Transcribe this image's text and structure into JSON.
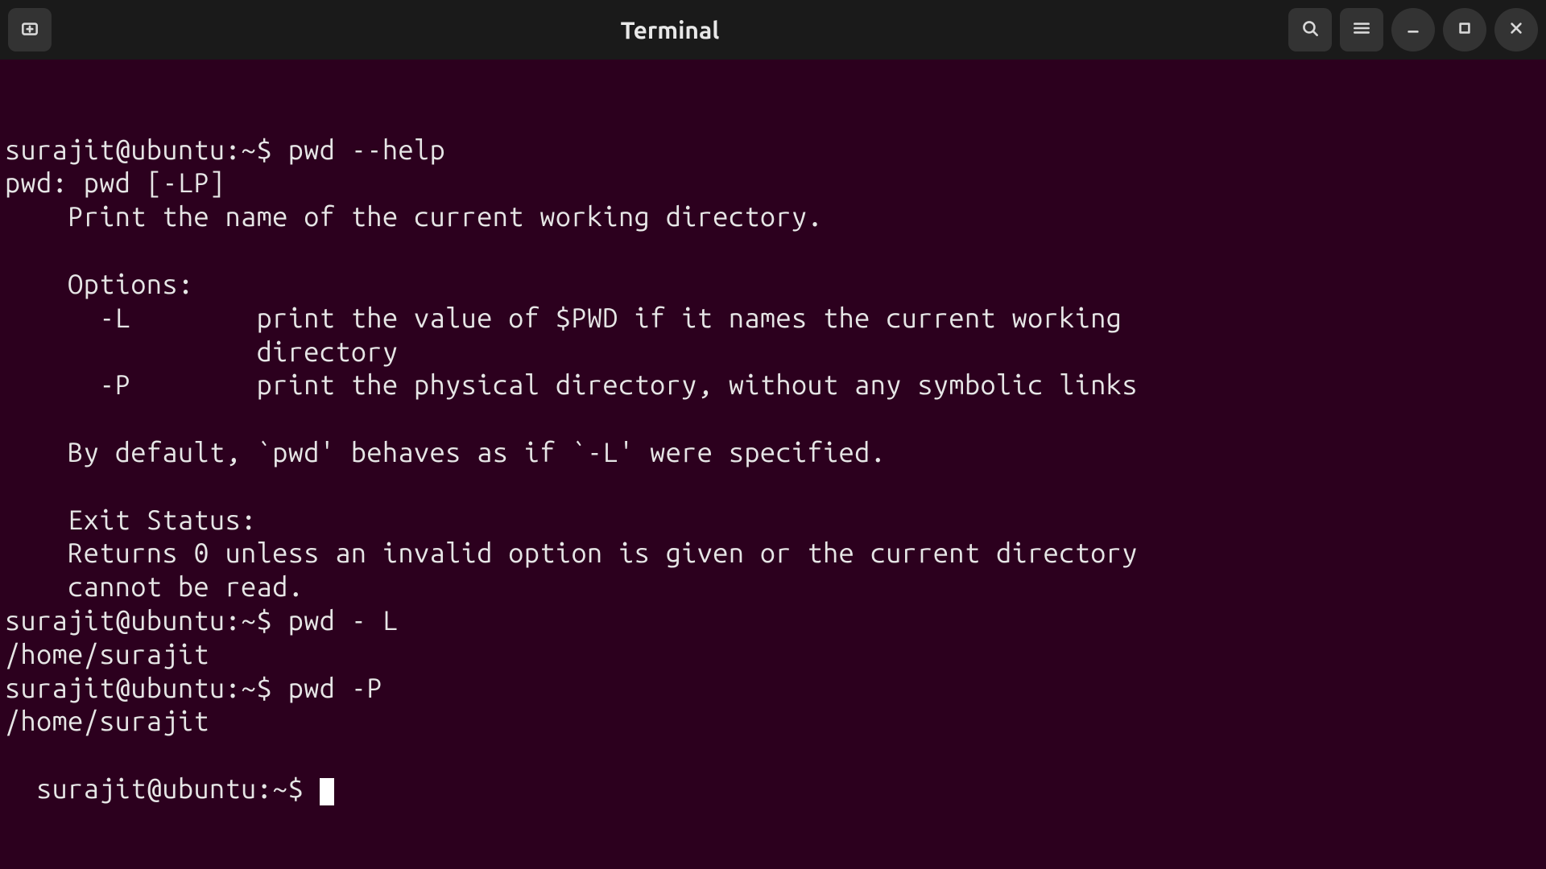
{
  "window": {
    "title": "Terminal"
  },
  "terminal": {
    "prompt": "surajit@ubuntu:~$ ",
    "lines": [
      "surajit@ubuntu:~$ pwd --help",
      "pwd: pwd [-LP]",
      "    Print the name of the current working directory.",
      "    ",
      "    Options:",
      "      -L        print the value of $PWD if it names the current working",
      "                directory",
      "      -P        print the physical directory, without any symbolic links",
      "    ",
      "    By default, `pwd' behaves as if `-L' were specified.",
      "    ",
      "    Exit Status:",
      "    Returns 0 unless an invalid option is given or the current directory",
      "    cannot be read.",
      "surajit@ubuntu:~$ pwd - L",
      "/home/surajit",
      "surajit@ubuntu:~$ pwd -P",
      "/home/surajit"
    ]
  }
}
